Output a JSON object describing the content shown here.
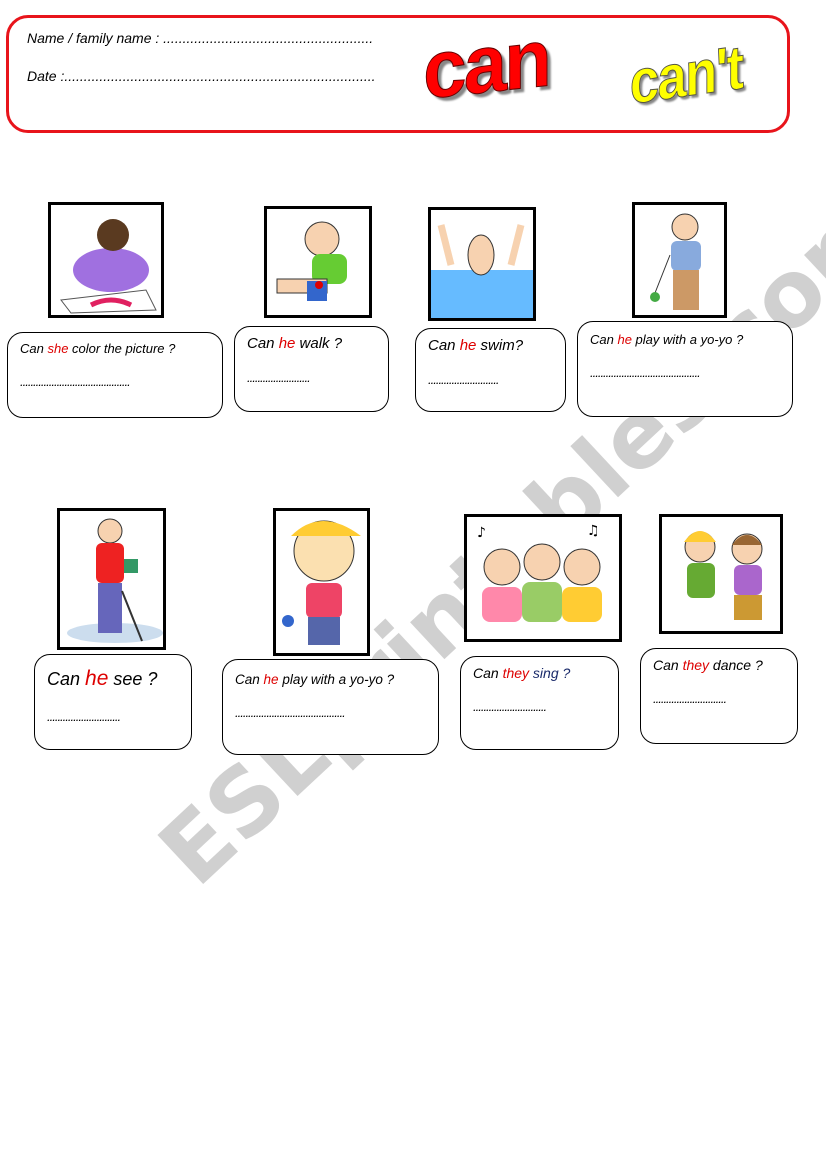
{
  "header": {
    "name_label": "Name / family name : ......................................................",
    "date_label": "Date :................................................................................",
    "title_can": "can",
    "title_cant": "can't"
  },
  "colors": {
    "border": "#e8141b",
    "subject": "#d00000",
    "can": "#ff0000",
    "cant": "#ffff00"
  },
  "questions": [
    {
      "pre": "Can ",
      "subject": "she",
      "post": " color the picture ?",
      "answer": "..........................................",
      "picture": "girl-coloring"
    },
    {
      "pre": "Can ",
      "subject": "he",
      "post": " walk ?",
      "answer": "........................",
      "picture": "boy-hurt-knee"
    },
    {
      "pre": "Can ",
      "subject": "he",
      "post": " swim?",
      "answer": "...........................",
      "picture": "boy-drowning"
    },
    {
      "pre": "Can ",
      "subject": "he",
      "post": " play with a yo-yo ?",
      "answer": "..........................................",
      "picture": "man-yoyo"
    },
    {
      "pre": "Can ",
      "subject": "he",
      "post": " see ?",
      "answer": "............................",
      "picture": "blind-man-cane"
    },
    {
      "pre": "Can ",
      "subject": "he",
      "post": " play with a yo-yo ?",
      "answer": "..........................................",
      "picture": "boy-yoyo"
    },
    {
      "pre": "Can ",
      "subject": "they",
      "post": " sing ?",
      "answer": "............................",
      "picture": "kids-singing"
    },
    {
      "pre": "Can ",
      "subject": "they",
      "post": " dance ?",
      "answer": "............................",
      "picture": "kids-dancing"
    }
  ],
  "watermark": "ESLprintables.com"
}
